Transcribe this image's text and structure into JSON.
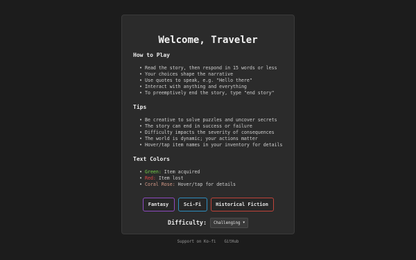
{
  "title": "Welcome, Traveler",
  "how_to_play": {
    "heading": "How to Play",
    "items": [
      "Read the story, then respond in 15 words or less",
      "Your choices shape the narrative",
      "Use quotes to speak, e.g. \"Hello there\"",
      "Interact with anything and everything",
      "To preemptively end the story, type \"end story\""
    ]
  },
  "tips": {
    "heading": "Tips",
    "items": [
      "Be creative to solve puzzles and uncover secrets",
      "The story can end in success or failure",
      "Difficulty impacts the severity of consequences",
      "The world is dynamic; your actions matter",
      "Hover/tap item names in your inventory for details"
    ]
  },
  "text_colors": {
    "heading": "Text Colors",
    "items": [
      {
        "label": "Green:",
        "desc": " Item acquired",
        "color": "#76d14a"
      },
      {
        "label": "Red:",
        "desc": " Item lost",
        "color": "#e04848"
      },
      {
        "label": "Coral Rose:",
        "desc": " Hover/tap for details",
        "color": "#d69a88"
      }
    ]
  },
  "genres": [
    {
      "label": "Fantasy",
      "border": "#8e4bc0"
    },
    {
      "label": "Sci-Fi",
      "border": "#2f8fc1"
    },
    {
      "label": "Historical Fiction",
      "border": "#c0443a"
    }
  ],
  "difficulty": {
    "label": "Difficulty:",
    "selected": "Challenging",
    "arrow": "▼"
  },
  "footer": {
    "kofi": "Support on Ko-fi",
    "github": "GitHub"
  }
}
